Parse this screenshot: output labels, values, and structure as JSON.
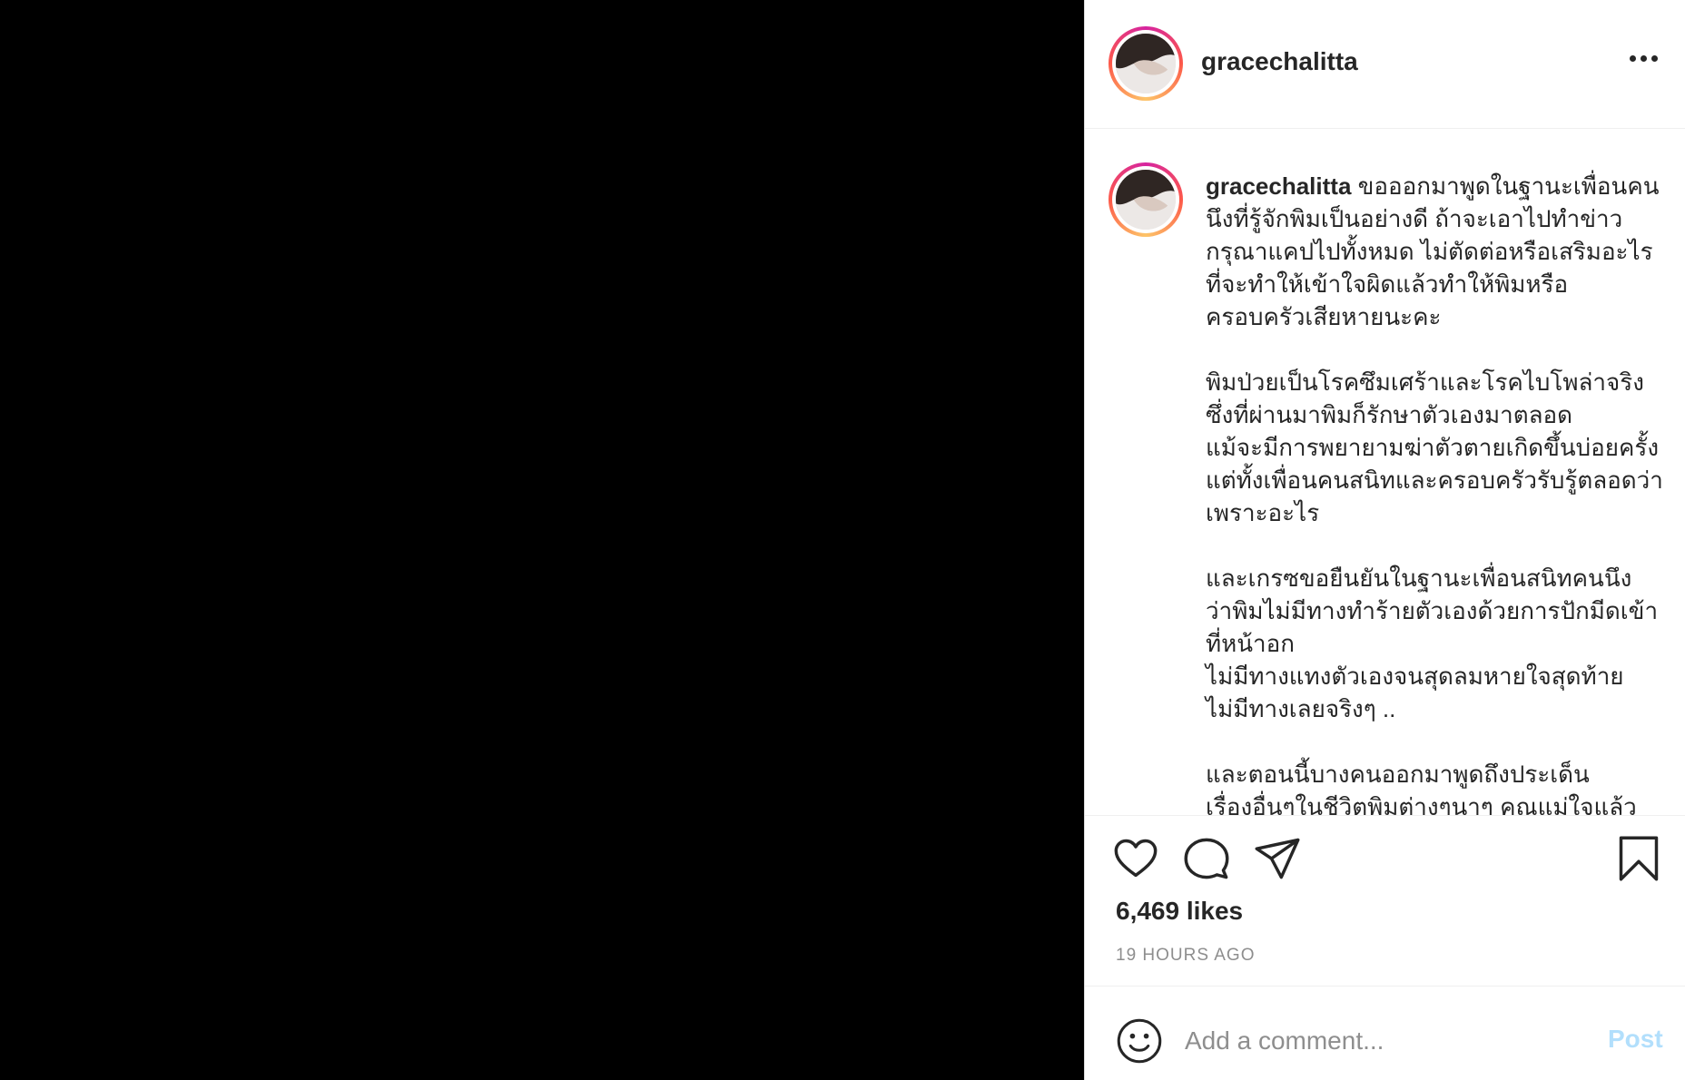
{
  "post": {
    "username": "gracechalitta",
    "caption_text": " ขอออกมาพูดในฐานะเพื่อนคนนึงที่รู้จักพิมเป็นอย่างดี ถ้าจะเอาไปทำข่าว\nกรุณาแคปไปทั้งหมด ไม่ตัดต่อหรือเสริมอะไร\nที่จะทำให้เข้าใจผิดแล้วทำให้พิมหรือ\nครอบครัวเสียหายนะคะ\n\nพิมป่วยเป็นโรคซึมเศร้าและโรคไบโพล่าจริง\nซึ่งที่ผ่านมาพิมก็รักษาตัวเองมาตลอด\nแม้จะมีการพยายามฆ่าตัวตายเกิดขึ้นบ่อยครั้ง\nแต่ทั้งเพื่อนคนสนิทและครอบครัวรับรู้ตลอดว่า\nเพราะอะไร\n\nและเกรซขอยืนยันในฐานะเพื่อนสนิทคนนึง\nว่าพิมไม่มีทางทำร้ายตัวเองด้วยการปักมีดเข้า\nที่หน้าอก\nไม่มีทางแทงตัวเองจนสุดลมหายใจสุดท้าย\nไม่มีทางเลยจริงๆ ..\n\nและตอนนี้บางคนออกมาพูดถึงประเด็น\nเรื่องอื่นๆในชีวิตพิมต่างๆนาๆ คุณแม่ใจแล้ว",
    "likes": "6,469 likes",
    "time_ago": "19 HOURS AGO"
  },
  "comment": {
    "placeholder": "Add a comment...",
    "post_label": "Post"
  },
  "icons": {
    "more": "more-options-icon",
    "like": "heart-icon",
    "comment": "comment-icon",
    "share": "share-icon",
    "save": "bookmark-icon",
    "emoji": "emoji-icon"
  },
  "colors": {
    "text": "#262626",
    "muted": "#8e8e8e",
    "post_disabled": "#b2dffc",
    "media_bg": "#000000"
  }
}
